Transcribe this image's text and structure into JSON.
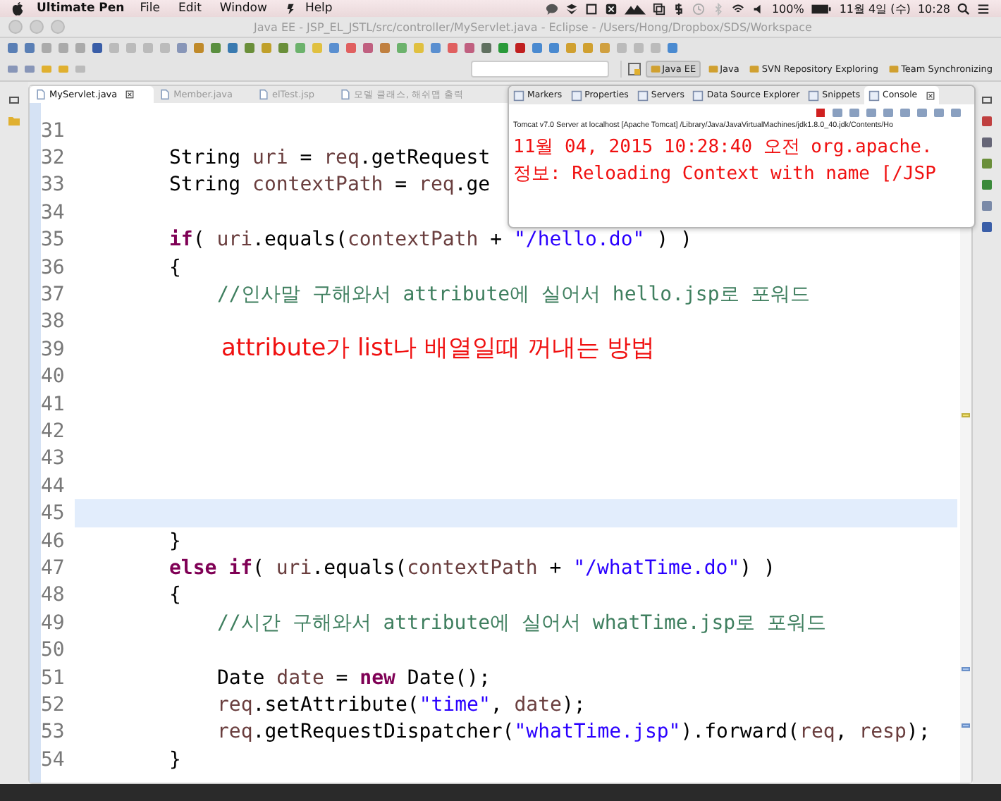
{
  "menubar": {
    "app_name": "Ultimate Pen",
    "menus": [
      "File",
      "Edit",
      "Window",
      "Help"
    ],
    "battery": "100%",
    "date": "11월 4일 (수)",
    "time": "10:28"
  },
  "window": {
    "title": "Java EE - JSP_EL_JSTL/src/controller/MyServlet.java - Eclipse - /Users/Hong/Dropbox/SDS/Workspace"
  },
  "perspectives": [
    {
      "label": "Java EE",
      "selected": true
    },
    {
      "label": "Java",
      "selected": false
    },
    {
      "label": "SVN Repository Exploring",
      "selected": false
    },
    {
      "label": "Team Synchronizing",
      "selected": false
    }
  ],
  "editor_tabs": [
    {
      "label": "MyServlet.java",
      "selected": true
    },
    {
      "label": "Member.java",
      "selected": false
    },
    {
      "label": "elTest.jsp",
      "selected": false
    },
    {
      "label": "모델 클래스, 해쉬맵 출력",
      "selected": false
    }
  ],
  "code_lines": [
    {
      "number": "31",
      "current": false
    },
    {
      "number": "32",
      "current": false,
      "kind": "outer",
      "segments": [
        {
          "kind": "plain",
          "text": "String "
        },
        {
          "kind": "local",
          "text": "uri"
        },
        {
          "kind": "plain",
          "text": " = "
        },
        {
          "kind": "local",
          "text": "req"
        },
        {
          "kind": "plain",
          "text": ".getRequest"
        }
      ]
    },
    {
      "number": "33",
      "current": false,
      "kind": "outer",
      "segments": [
        {
          "kind": "plain",
          "text": "String "
        },
        {
          "kind": "local",
          "text": "contextPath"
        },
        {
          "kind": "plain",
          "text": " = "
        },
        {
          "kind": "local",
          "text": "req"
        },
        {
          "kind": "plain",
          "text": ".ge"
        }
      ]
    },
    {
      "number": "34",
      "current": false
    },
    {
      "number": "35",
      "current": false,
      "kind": "outer",
      "segments": [
        {
          "kind": "keyword",
          "text": "if"
        },
        {
          "kind": "plain",
          "text": "( "
        },
        {
          "kind": "local",
          "text": "uri"
        },
        {
          "kind": "plain",
          "text": ".equals("
        },
        {
          "kind": "local",
          "text": "contextPath"
        },
        {
          "kind": "plain",
          "text": " + "
        },
        {
          "kind": "string",
          "text": "\"/hello.do\""
        },
        {
          "kind": "plain",
          "text": " ) )"
        }
      ]
    },
    {
      "number": "36",
      "current": false,
      "kind": "outer",
      "segments": [
        {
          "kind": "plain",
          "text": "{"
        }
      ]
    },
    {
      "number": "37",
      "current": false,
      "kind": "inner",
      "segments": [
        {
          "kind": "comment",
          "text": "//인사말 구해와서 attribute에 실어서 hello.jsp로 포워드"
        }
      ]
    },
    {
      "number": "38",
      "current": false
    },
    {
      "number": "39",
      "current": false
    },
    {
      "number": "40",
      "current": false
    },
    {
      "number": "41",
      "current": false
    },
    {
      "number": "42",
      "current": false
    },
    {
      "number": "43",
      "current": false
    },
    {
      "number": "44",
      "current": false
    },
    {
      "number": "45",
      "current": true
    },
    {
      "number": "46",
      "current": false,
      "kind": "outer",
      "segments": [
        {
          "kind": "plain",
          "text": "}"
        }
      ]
    },
    {
      "number": "47",
      "current": false,
      "kind": "outer",
      "segments": [
        {
          "kind": "keyword",
          "text": "else if"
        },
        {
          "kind": "plain",
          "text": "( "
        },
        {
          "kind": "local",
          "text": "uri"
        },
        {
          "kind": "plain",
          "text": ".equals("
        },
        {
          "kind": "local",
          "text": "contextPath"
        },
        {
          "kind": "plain",
          "text": " + "
        },
        {
          "kind": "string",
          "text": "\"/whatTime.do\""
        },
        {
          "kind": "plain",
          "text": ") )"
        }
      ]
    },
    {
      "number": "48",
      "current": false,
      "kind": "outer",
      "segments": [
        {
          "kind": "plain",
          "text": "{"
        }
      ]
    },
    {
      "number": "49",
      "current": false,
      "kind": "inner",
      "segments": [
        {
          "kind": "comment",
          "text": "//시간 구해와서 attribute에 실어서 whatTime.jsp로 포워드"
        }
      ]
    },
    {
      "number": "50",
      "current": false
    },
    {
      "number": "51",
      "current": false,
      "kind": "inner",
      "segments": [
        {
          "kind": "plain",
          "text": "Date "
        },
        {
          "kind": "local",
          "text": "date"
        },
        {
          "kind": "plain",
          "text": " = "
        },
        {
          "kind": "keyword",
          "text": "new"
        },
        {
          "kind": "plain",
          "text": " Date();"
        }
      ]
    },
    {
      "number": "52",
      "current": false,
      "kind": "inner",
      "segments": [
        {
          "kind": "local",
          "text": "req"
        },
        {
          "kind": "plain",
          "text": ".setAttribute("
        },
        {
          "kind": "string",
          "text": "\"time\""
        },
        {
          "kind": "plain",
          "text": ", "
        },
        {
          "kind": "local",
          "text": "date"
        },
        {
          "kind": "plain",
          "text": ");"
        }
      ]
    },
    {
      "number": "53",
      "current": false,
      "kind": "inner",
      "segments": [
        {
          "kind": "local",
          "text": "req"
        },
        {
          "kind": "plain",
          "text": ".getRequestDispatcher("
        },
        {
          "kind": "string",
          "text": "\"whatTime.jsp\""
        },
        {
          "kind": "plain",
          "text": ").forward("
        },
        {
          "kind": "local",
          "text": "req"
        },
        {
          "kind": "plain",
          "text": ", "
        },
        {
          "kind": "local",
          "text": "resp"
        },
        {
          "kind": "plain",
          "text": ");"
        }
      ]
    },
    {
      "number": "54",
      "current": false,
      "kind": "outer",
      "segments": [
        {
          "kind": "plain",
          "text": "}"
        }
      ]
    }
  ],
  "annotation": "attribute가 list나 배열일때 꺼내는 방법",
  "console_panel": {
    "tabs": [
      {
        "label": "Markers",
        "selected": false
      },
      {
        "label": "Properties",
        "selected": false
      },
      {
        "label": "Servers",
        "selected": false
      },
      {
        "label": "Data Source Explorer",
        "selected": false
      },
      {
        "label": "Snippets",
        "selected": false
      },
      {
        "label": "Console",
        "selected": true
      }
    ],
    "header": "Tomcat v7.0 Server at localhost [Apache Tomcat] /Library/Java/JavaVirtualMachines/jdk1.8.0_40.jdk/Contents/Ho",
    "lines": [
      "11월 04, 2015 10:28:40 오전 org.apache.",
      "정보: Reloading Context with name [/JSP"
    ]
  }
}
